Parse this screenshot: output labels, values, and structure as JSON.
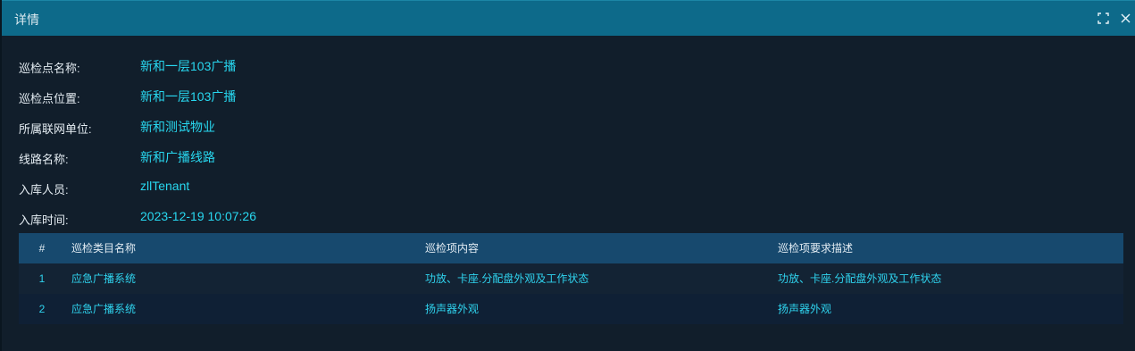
{
  "dialog": {
    "title": "详情"
  },
  "details": [
    {
      "label": "巡检点名称:",
      "value": "新和一层103广播"
    },
    {
      "label": "巡检点位置:",
      "value": "新和一层103广播"
    },
    {
      "label": "所属联网单位:",
      "value": "新和测试物业"
    },
    {
      "label": "线路名称:",
      "value": "新和广播线路"
    },
    {
      "label": "入库人员:",
      "value": "zllTenant"
    },
    {
      "label": "入库时间:",
      "value": "2023-12-19 10:07:26"
    }
  ],
  "table": {
    "headers": [
      "#",
      "巡检类目名称",
      "巡检项内容",
      "巡检项要求描述"
    ],
    "rows": [
      [
        "1",
        "应急广播系统",
        "功放、卡座.分配盘外观及工作状态",
        "功放、卡座.分配盘外观及工作状态"
      ],
      [
        "2",
        "应急广播系统",
        "扬声器外观",
        "扬声器外观"
      ]
    ]
  },
  "icons": {
    "fullscreen": "fullscreen-icon",
    "close": "close-icon"
  },
  "colors": {
    "titlebar": "#0d6a8a",
    "background": "#111e2b",
    "value_text": "#28d8f0",
    "table_header": "#17496e"
  }
}
